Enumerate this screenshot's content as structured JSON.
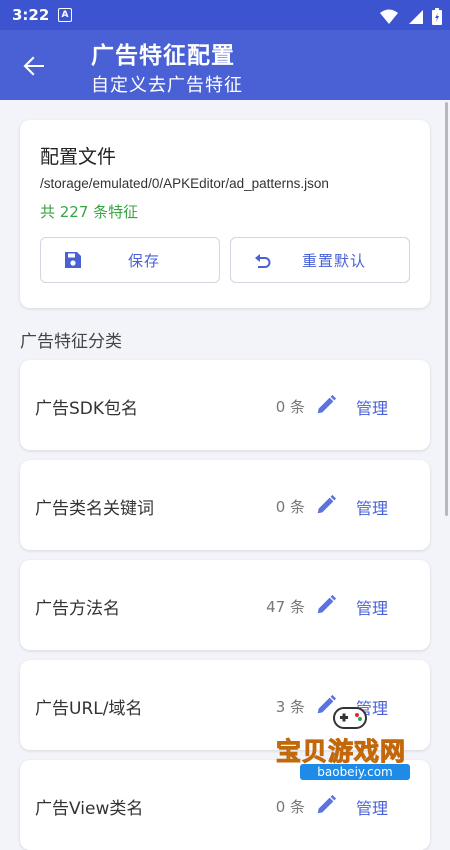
{
  "status_bar": {
    "time": "3:22",
    "app_badge": "A"
  },
  "app_bar": {
    "title": "广告特征配置",
    "subtitle": "自定义去广告特征"
  },
  "config": {
    "title": "配置文件",
    "path": "/storage/emulated/0/APKEditor/ad_patterns.json",
    "count_text": "共 227 条特征",
    "save_label": "保存",
    "reset_label": "重置默认"
  },
  "section_title": "广告特征分类",
  "categories": [
    {
      "name": "广告SDK包名",
      "count": "0 条",
      "manage": "管理"
    },
    {
      "name": "广告类名关键词",
      "count": "0 条",
      "manage": "管理"
    },
    {
      "name": "广告方法名",
      "count": "47 条",
      "manage": "管理"
    },
    {
      "name": "广告URL/域名",
      "count": "3 条",
      "manage": "管理"
    },
    {
      "name": "广告View类名",
      "count": "0 条",
      "manage": "管理"
    }
  ],
  "watermark": {
    "text": "宝贝游戏网",
    "url": "baobeiy.com"
  },
  "colors": {
    "primary": "#4a61d6",
    "status_bar": "#3c54cf",
    "success": "#3aa545",
    "background": "#f3f4f9"
  }
}
